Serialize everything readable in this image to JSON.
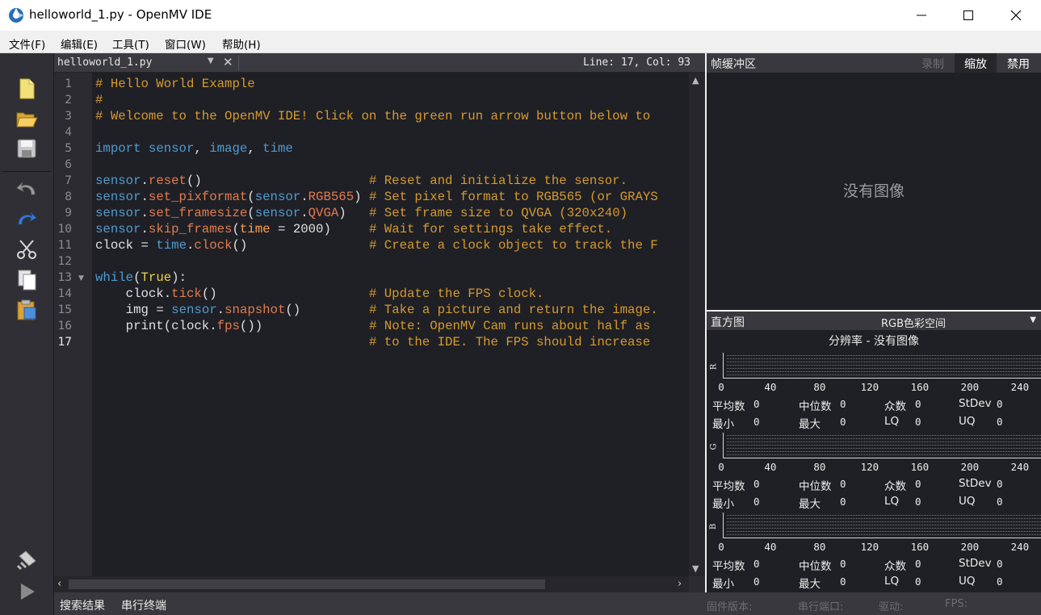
{
  "window": {
    "title": "helloworld_1.py - OpenMV IDE",
    "minimize_icon": "minimize-icon",
    "maximize_icon": "maximize-icon",
    "close_icon": "close-icon"
  },
  "menu": [
    {
      "label": "文件(F)"
    },
    {
      "label": "编辑(E)"
    },
    {
      "label": "工具(T)"
    },
    {
      "label": "窗口(W)"
    },
    {
      "label": "帮助(H)"
    }
  ],
  "toolbar": [
    {
      "icon": "new-file-icon"
    },
    {
      "icon": "open-folder-icon"
    },
    {
      "icon": "save-icon"
    },
    {
      "icon": "undo-icon"
    },
    {
      "icon": "redo-icon"
    },
    {
      "icon": "cut-icon"
    },
    {
      "icon": "copy-icon"
    },
    {
      "icon": "paste-icon"
    },
    {
      "icon": "connect-icon"
    },
    {
      "icon": "run-icon"
    }
  ],
  "editor": {
    "file_name": "helloworld_1.py",
    "cursor": "Line: 17, Col: 93",
    "current_line": 17,
    "folded_lines": [
      13,
      14,
      15,
      16
    ],
    "lines": [
      "# Hello World Example",
      "#",
      "# Welcome to the OpenMV IDE! Click on the green run arrow button below to",
      "",
      "import sensor, image, time",
      "",
      "sensor.reset()                      # Reset and initialize the sensor.",
      "sensor.set_pixformat(sensor.RGB565) # Set pixel format to RGB565 (or GRAYS",
      "sensor.set_framesize(sensor.QVGA)   # Set frame size to QVGA (320x240)",
      "sensor.skip_frames(time = 2000)     # Wait for settings take effect.",
      "clock = time.clock()                # Create a clock object to track the F",
      "",
      "while(True):",
      "    clock.tick()                    # Update the FPS clock.",
      "    img = sensor.snapshot()         # Take a picture and return the image.",
      "    print(clock.fps())              # Note: OpenMV Cam runs about half as",
      "                                    # to the IDE. The FPS should increase"
    ]
  },
  "bottom": {
    "tab_search": "搜索结果",
    "tab_serial": "串行终端",
    "firmware": "固件版本:",
    "serial_port": "串行端口:",
    "driver": "驱动:",
    "fps": "FPS:"
  },
  "framebuffer": {
    "title": "帧缓冲区",
    "record": "录制",
    "zoom": "缩放",
    "disable": "禁用",
    "no_image": "没有图像"
  },
  "histogram": {
    "title": "直方图",
    "color_space": "RGB色彩空间",
    "resolution": "分辨率 - 没有图像",
    "ticks": [
      "0",
      "40",
      "80",
      "120",
      "160",
      "200",
      "240"
    ],
    "channels": [
      {
        "name": "R",
        "mean_label": "平均数",
        "mean": "0",
        "median_label": "中位数",
        "median": "0",
        "mode_label": "众数",
        "mode": "0",
        "stdev_label": "StDev",
        "stdev": "0",
        "min_label": "最小",
        "min": "0",
        "max_label": "最大",
        "max": "0",
        "lq_label": "LQ",
        "lq": "0",
        "uq_label": "UQ",
        "uq": "0"
      },
      {
        "name": "G",
        "mean_label": "平均数",
        "mean": "0",
        "median_label": "中位数",
        "median": "0",
        "mode_label": "众数",
        "mode": "0",
        "stdev_label": "StDev",
        "stdev": "0",
        "min_label": "最小",
        "min": "0",
        "max_label": "最大",
        "max": "0",
        "lq_label": "LQ",
        "lq": "0",
        "uq_label": "UQ",
        "uq": "0"
      },
      {
        "name": "B",
        "mean_label": "平均数",
        "mean": "0",
        "median_label": "中位数",
        "median": "0",
        "mode_label": "众数",
        "mode": "0",
        "stdev_label": "StDev",
        "stdev": "0",
        "min_label": "最小",
        "min": "0",
        "max_label": "最大",
        "max": "0",
        "lq_label": "LQ",
        "lq": "0",
        "uq_label": "UQ",
        "uq": "0"
      }
    ]
  }
}
